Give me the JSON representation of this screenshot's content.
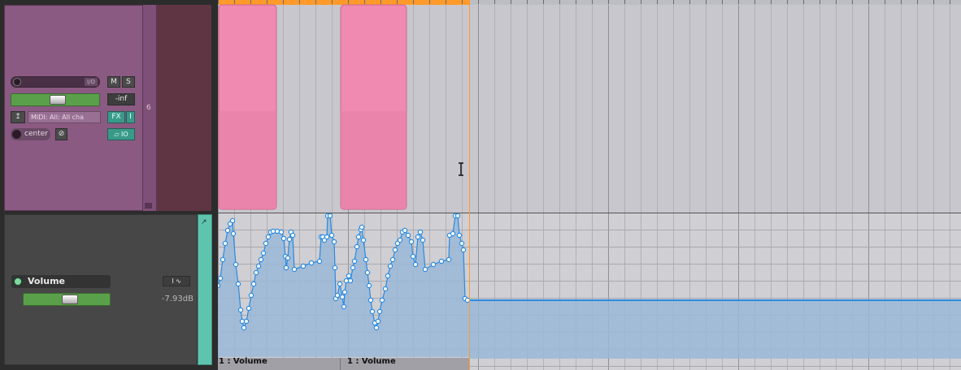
{
  "track": {
    "number": "6",
    "io_label": "I/O",
    "mute_label": "M",
    "solo_label": "S",
    "volume_readout": "-inf",
    "midi_input": "MIDI: All: All cha",
    "fx_label": "FX",
    "fx_toggle": "I",
    "pan_label": "center",
    "io_small": "IO"
  },
  "envelope": {
    "name": "Volume",
    "value": "-7.93dB",
    "item_labels": [
      "1 : Volume",
      "1 : Volume"
    ]
  },
  "colors": {
    "track": "#8a5a82",
    "item": "#f08ab0",
    "envelope_line": "#2a8ae0",
    "envelope_fill": "#9ab8d8",
    "edit_cursor": "#ff9a2a",
    "teal": "#5fc4ad"
  },
  "icons": [
    "record-arm-icon",
    "envelope-icon",
    "phase-icon",
    "mute-icon",
    "lock-icon",
    "arrow-icon"
  ]
}
